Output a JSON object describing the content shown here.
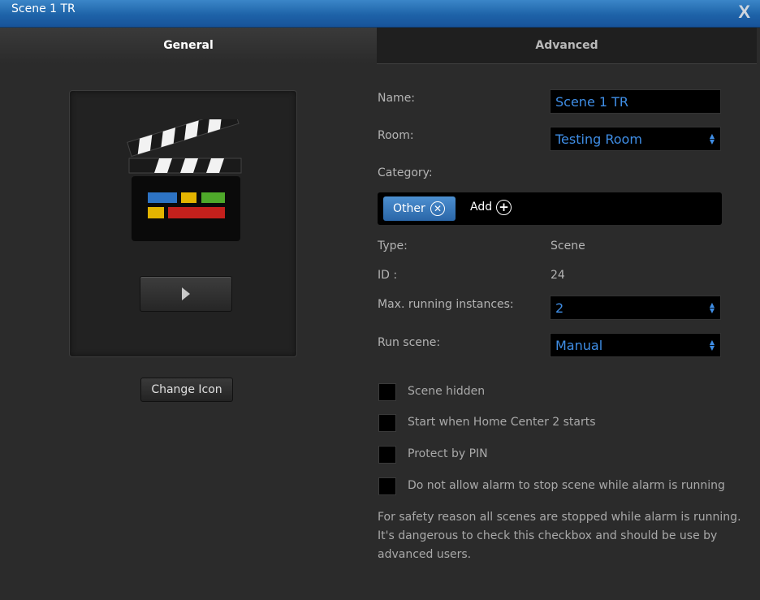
{
  "window": {
    "title": "Scene 1 TR",
    "close_label": "X"
  },
  "tabs": [
    {
      "label": "General",
      "active": true
    },
    {
      "label": "Advanced",
      "active": false
    }
  ],
  "left": {
    "icon": "clapperboard-icon",
    "play_icon": "play-icon",
    "change_icon_label": "Change Icon"
  },
  "form": {
    "name_label": "Name:",
    "name_value": "Scene 1 TR",
    "room_label": "Room:",
    "room_value": "Testing Room",
    "category_label": "Category:",
    "category_tag": "Other",
    "category_add": "Add",
    "type_label": "Type:",
    "type_value": "Scene",
    "id_label": "ID :",
    "id_value": "24",
    "max_label": "Max. running instances:",
    "max_value": "2",
    "run_label": "Run scene:",
    "run_value": "Manual"
  },
  "checkboxes": [
    {
      "label": "Scene hidden",
      "checked": false
    },
    {
      "label": "Start when Home Center 2 starts",
      "checked": false
    },
    {
      "label": "Protect by PIN",
      "checked": false
    },
    {
      "label": "Do not allow alarm to stop scene while alarm is running",
      "checked": false
    }
  ],
  "note": "For safety reason all scenes are stopped while alarm is running. It's dangerous to check this checkbox and should be use by advanced users.",
  "colors": {
    "accent": "#3f8ee6",
    "titlebar": "#1e63a8",
    "background": "#2b2b2b"
  }
}
